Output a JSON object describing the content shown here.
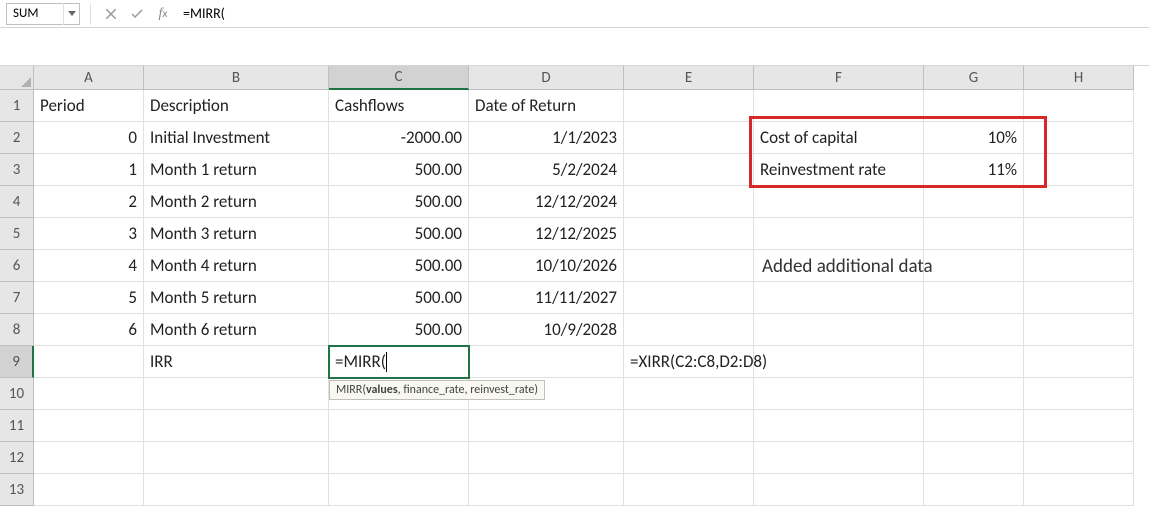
{
  "nameBox": "SUM",
  "formulaBar": "=MIRR(",
  "tooltip": {
    "fn": "MIRR",
    "args": [
      "values",
      "finance_rate",
      "reinvest_rate"
    ],
    "boldIdx": 0
  },
  "cols": [
    "A",
    "B",
    "C",
    "D",
    "E",
    "F",
    "G",
    "H"
  ],
  "rows": [
    "1",
    "2",
    "3",
    "4",
    "5",
    "6",
    "7",
    "8",
    "9",
    "10",
    "11",
    "12",
    "13"
  ],
  "activeCol": "C",
  "activeRow": "9",
  "annotation": "Added additional data",
  "cells": {
    "A1": "Period",
    "B1": "Description",
    "C1": "Cashflows",
    "D1": "Date of Return",
    "A2": "0",
    "B2": "Initial Investment",
    "C2": "-2000.00",
    "D2": "1/1/2023",
    "A3": "1",
    "B3": "Month 1 return",
    "C3": "500.00",
    "D3": "5/2/2024",
    "A4": "2",
    "B4": "Month 2 return",
    "C4": "500.00",
    "D4": "12/12/2024",
    "A5": "3",
    "B5": "Month 3 return",
    "C5": "500.00",
    "D5": "12/12/2025",
    "A6": "4",
    "B6": "Month 4 return",
    "C6": "500.00",
    "D6": "10/10/2026",
    "A7": "5",
    "B7": "Month 5 return",
    "C7": "500.00",
    "D7": "11/11/2027",
    "A8": "6",
    "B8": "Month 6 return",
    "C8": "500.00",
    "D8": "10/9/2028",
    "B9": "IRR",
    "C9": "=MIRR(",
    "E9": "=XIRR(C2:C8,D2:D8)",
    "F2": "Cost of capital",
    "G2": "10%",
    "F3": "Reinvestment rate",
    "G3": "11%"
  }
}
